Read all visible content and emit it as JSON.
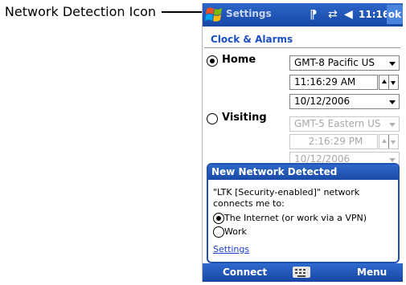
{
  "callout": {
    "label": "Network Detection Icon"
  },
  "titlebar": {
    "title": "Settings",
    "time": "11:16",
    "ok_label": "ok",
    "icons": [
      "start-logo-icon",
      "antenna-icon",
      "connectivity-icon",
      "volume-icon"
    ]
  },
  "page": {
    "heading": "Clock & Alarms"
  },
  "home": {
    "label": "Home",
    "selected": true,
    "timezone": "GMT-8 Pacific US",
    "time": "11:16:29 AM",
    "date": "10/12/2006"
  },
  "visiting": {
    "label": "Visiting",
    "selected": false,
    "timezone": "GMT-5 Eastern US",
    "time": "2:16:29 PM",
    "date": "10/12/2006"
  },
  "dialog": {
    "title": "New Network Detected",
    "message": "\"LTK [Security-enabled]\" network connects me to:",
    "options": [
      {
        "label": "The Internet (or work via a VPN)",
        "selected": true
      },
      {
        "label": "Work",
        "selected": false
      }
    ],
    "settings_link": "Settings"
  },
  "menubar": {
    "left": "Connect",
    "right": "Menu",
    "center_icon": "keyboard-icon"
  },
  "colors": {
    "titlebar": "#1f56b8",
    "heading": "#1b4ec4",
    "link": "#1b3fd6",
    "disabled_text": "#a8a8a8"
  }
}
